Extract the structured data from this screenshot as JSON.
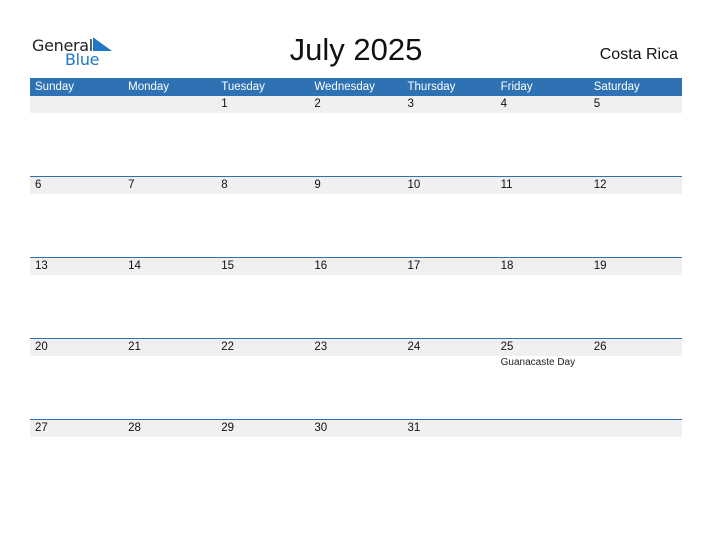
{
  "logo": {
    "line1": "General",
    "line2": "Blue",
    "accent_color": "#1f77c8"
  },
  "title": "July 2025",
  "country": "Costa Rica",
  "header_color": "#2e72b4",
  "weekdays": [
    "Sunday",
    "Monday",
    "Tuesday",
    "Wednesday",
    "Thursday",
    "Friday",
    "Saturday"
  ],
  "weeks": [
    {
      "days": [
        {
          "num": "",
          "event": ""
        },
        {
          "num": "",
          "event": ""
        },
        {
          "num": "1",
          "event": ""
        },
        {
          "num": "2",
          "event": ""
        },
        {
          "num": "3",
          "event": ""
        },
        {
          "num": "4",
          "event": ""
        },
        {
          "num": "5",
          "event": ""
        }
      ]
    },
    {
      "days": [
        {
          "num": "6",
          "event": ""
        },
        {
          "num": "7",
          "event": ""
        },
        {
          "num": "8",
          "event": ""
        },
        {
          "num": "9",
          "event": ""
        },
        {
          "num": "10",
          "event": ""
        },
        {
          "num": "11",
          "event": ""
        },
        {
          "num": "12",
          "event": ""
        }
      ]
    },
    {
      "days": [
        {
          "num": "13",
          "event": ""
        },
        {
          "num": "14",
          "event": ""
        },
        {
          "num": "15",
          "event": ""
        },
        {
          "num": "16",
          "event": ""
        },
        {
          "num": "17",
          "event": ""
        },
        {
          "num": "18",
          "event": ""
        },
        {
          "num": "19",
          "event": ""
        }
      ]
    },
    {
      "days": [
        {
          "num": "20",
          "event": ""
        },
        {
          "num": "21",
          "event": ""
        },
        {
          "num": "22",
          "event": ""
        },
        {
          "num": "23",
          "event": ""
        },
        {
          "num": "24",
          "event": ""
        },
        {
          "num": "25",
          "event": "Guanacaste Day"
        },
        {
          "num": "26",
          "event": ""
        }
      ]
    },
    {
      "days": [
        {
          "num": "27",
          "event": ""
        },
        {
          "num": "28",
          "event": ""
        },
        {
          "num": "29",
          "event": ""
        },
        {
          "num": "30",
          "event": ""
        },
        {
          "num": "31",
          "event": ""
        },
        {
          "num": "",
          "event": ""
        },
        {
          "num": "",
          "event": ""
        }
      ]
    }
  ]
}
